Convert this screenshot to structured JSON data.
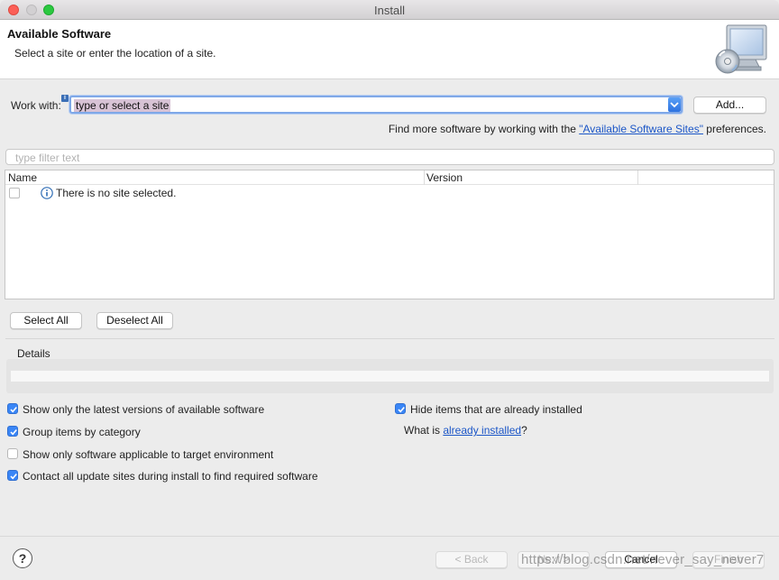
{
  "window": {
    "title": "Install"
  },
  "banner": {
    "title": "Available Software",
    "subtitle": "Select a site or enter the location of a site."
  },
  "work_with": {
    "label": "Work with:",
    "value": "type or select a site",
    "add_button": "Add..."
  },
  "find_more": {
    "prefix": "Find more software by working with the ",
    "link": "\"Available Software Sites\"",
    "suffix": " preferences."
  },
  "filter": {
    "placeholder": "type filter text"
  },
  "table": {
    "columns": [
      "Name",
      "Version"
    ],
    "empty_message": "There is no site selected."
  },
  "selection_buttons": {
    "select_all": "Select All",
    "deselect_all": "Deselect All"
  },
  "details": {
    "label": "Details"
  },
  "options": {
    "latest_versions": {
      "label": "Show only the latest versions of available software",
      "checked": true
    },
    "group_by_category": {
      "label": "Group items by category",
      "checked": true
    },
    "target_env": {
      "label": "Show only software applicable to target environment",
      "checked": false
    },
    "contact_sites": {
      "label": "Contact all update sites during install to find required software",
      "checked": true
    },
    "hide_installed": {
      "label": "Hide items that are already installed",
      "checked": true
    },
    "what_is": {
      "prefix": "What is ",
      "link": "already installed",
      "suffix": "?"
    }
  },
  "footer": {
    "help": "?",
    "back": "< Back",
    "next": "Next >",
    "cancel": "Cancel",
    "finish": "Finish"
  },
  "watermark": "https://blog.csdn.net/never_say_never7",
  "colors": {
    "accent": "#3a86f6",
    "link": "#1b56c7",
    "close": "#fc5f57",
    "maximize": "#2bc840"
  }
}
